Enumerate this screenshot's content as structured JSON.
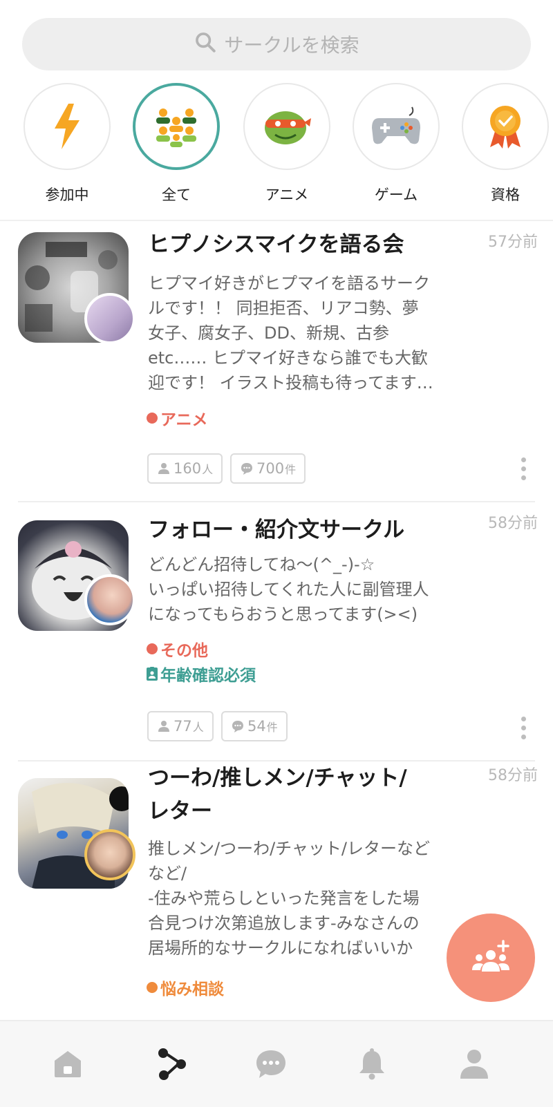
{
  "search": {
    "placeholder": "サークルを検索",
    "icon": "search-icon"
  },
  "categories": [
    {
      "label": "参加中",
      "icon": "lightning-icon"
    },
    {
      "label": "全て",
      "icon": "group-icon",
      "active": true
    },
    {
      "label": "アニメ",
      "icon": "ninja-turtle-icon"
    },
    {
      "label": "ゲーム",
      "icon": "gamepad-icon"
    },
    {
      "label": "資格",
      "icon": "medal-icon"
    }
  ],
  "circles": [
    {
      "title": "ヒプノシスマイクを語る会",
      "time": "57分前",
      "desc": [
        "ヒプマイ好きがヒプマイを語るサーク",
        "ルです！！ 同担拒否、リアコ勢、夢",
        "女子、腐女子、DD、新規、古参",
        "etc…… ヒプマイ好きなら誰でも大歓",
        "迎です！ イラスト投稿も待ってます…"
      ],
      "tag": "アニメ",
      "tag_color": "#e8695a",
      "members": "160",
      "members_unit": "人",
      "posts": "700",
      "posts_unit": "件"
    },
    {
      "title": "フォロー・紹介文サークル",
      "time": "58分前",
      "desc": [
        "どんどん招待してね〜(^_-)-☆",
        "いっぱい招待してくれた人に副管理人",
        "になってもらおうと思ってます(><)"
      ],
      "tag": "その他",
      "tag_color": "#e8695a",
      "age_check": "年齢確認必須",
      "members": "77",
      "members_unit": "人",
      "posts": "54",
      "posts_unit": "件"
    },
    {
      "title_lines": [
        "つーわ/推しメン/チャット/",
        "レター"
      ],
      "time": "58分前",
      "desc": [
        "推しメン/つーわ/チャット/レターなど",
        "など/",
        "-住みや荒らしといった発言をした場",
        "合見つけ次第追放します-みなさんの",
        "居場所的なサークルになればいいか"
      ],
      "tag": "悩み相談",
      "tag_color": "#ef8b3c"
    }
  ],
  "colors": {
    "accent": "#4aa99f",
    "fab": "#f5917a",
    "tag_red": "#e8695a",
    "tag_orange": "#ef8b3c"
  },
  "bottom_nav": [
    "home-icon",
    "circles-icon",
    "chat-icon",
    "bell-icon",
    "profile-icon"
  ]
}
